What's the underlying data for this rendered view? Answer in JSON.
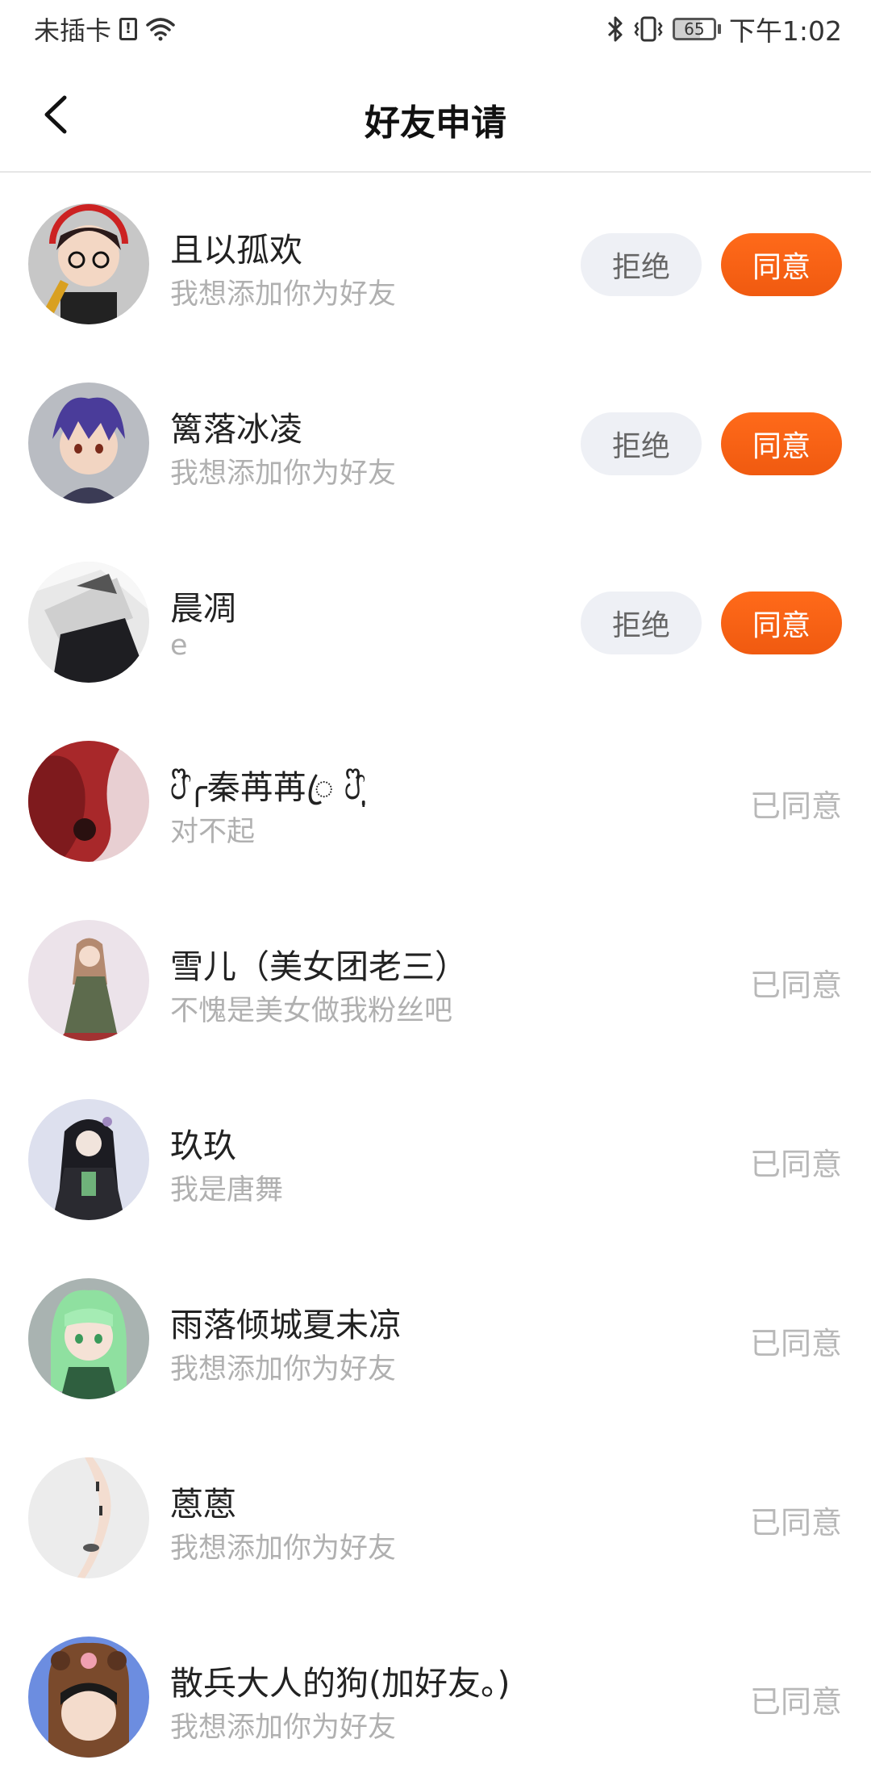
{
  "status_bar": {
    "carrier": "未插卡",
    "sim_icon_label": "!",
    "battery": "65",
    "time": "下午1:02",
    "icons": [
      "sim-alert-icon",
      "wifi-icon",
      "bluetooth-icon",
      "vibrate-icon",
      "battery-icon"
    ]
  },
  "header": {
    "title": "好友申请",
    "back_icon": "chevron-left-icon"
  },
  "actions": {
    "reject": "拒绝",
    "accept": "同意",
    "accepted": "已同意"
  },
  "requests": [
    {
      "name": "且以孤欢",
      "message": "我想添加你为好友",
      "status": "pending"
    },
    {
      "name": "篱落冰凌",
      "message": "我想添加你为好友",
      "status": "pending"
    },
    {
      "name": "晨凋",
      "message": "e",
      "status": "pending"
    },
    {
      "name": "ᦔᩚ╭秦苒苒ꦿ ᦔᩚ ̣̩",
      "message": "对不起",
      "status": "accepted"
    },
    {
      "name": "雪儿（美女团老三）",
      "message": "不愧是美女做我粉丝吧",
      "status": "accepted"
    },
    {
      "name": "玖玖",
      "message": "我是唐舞",
      "status": "accepted"
    },
    {
      "name": "雨落倾城夏未凉",
      "message": "我想添加你为好友",
      "status": "accepted"
    },
    {
      "name": "蒽蒽",
      "message": "我想添加你为好友",
      "status": "accepted"
    },
    {
      "name": "散兵大人的狗(加好友。)",
      "message": "我想添加你为好友",
      "status": "accepted"
    }
  ],
  "colors": {
    "accent": "#f05a10",
    "reject_bg": "#eef0f5",
    "muted_text": "#b0b0b0"
  }
}
